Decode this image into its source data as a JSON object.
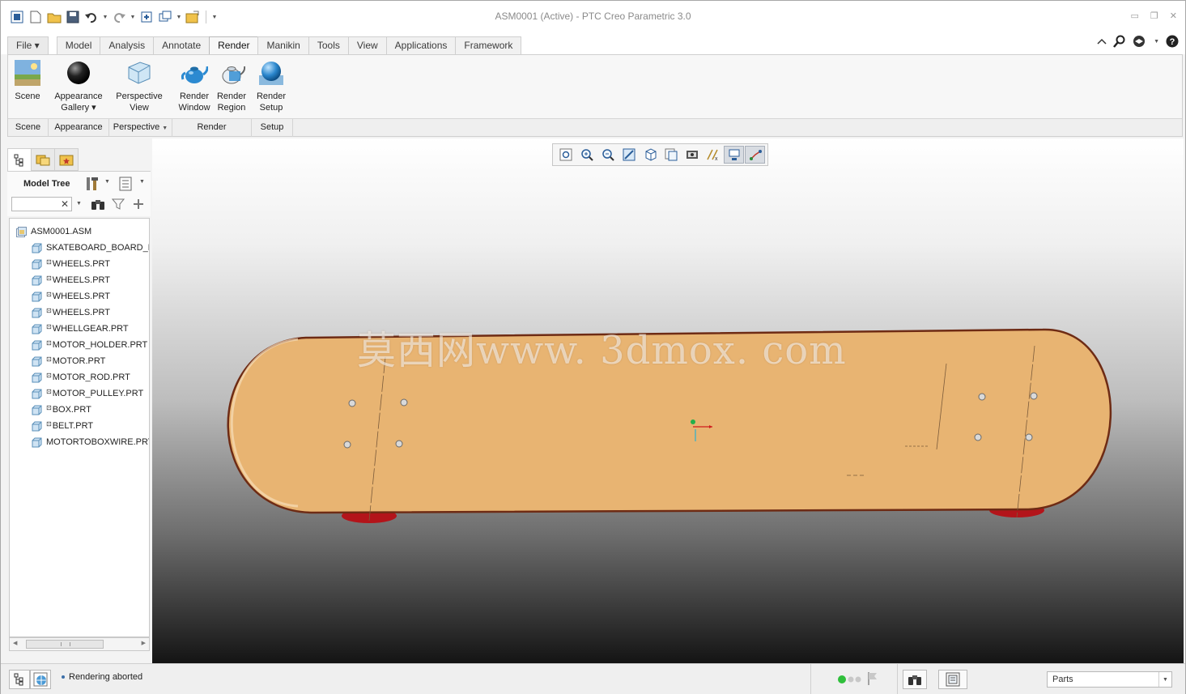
{
  "window": {
    "title": "ASM0001 (Active) - PTC Creo Parametric 3.0"
  },
  "tabs": [
    {
      "label": "File"
    },
    {
      "label": "Model"
    },
    {
      "label": "Analysis"
    },
    {
      "label": "Annotate"
    },
    {
      "label": "Render"
    },
    {
      "label": "Manikin"
    },
    {
      "label": "Tools"
    },
    {
      "label": "View"
    },
    {
      "label": "Applications"
    },
    {
      "label": "Framework"
    }
  ],
  "ribbon": {
    "buttons": {
      "scene": "Scene",
      "appearance_line1": "Appearance",
      "appearance_line2": "Gallery",
      "perspective_line1": "Perspective",
      "perspective_line2": "View",
      "render_window_line1": "Render",
      "render_window_line2": "Window",
      "render_region_line1": "Render",
      "render_region_line2": "Region",
      "render_setup_line1": "Render",
      "render_setup_line2": "Setup"
    },
    "groups": {
      "scene": "Scene",
      "appearance": "Appearance",
      "perspective": "Perspective",
      "render": "Render",
      "setup": "Setup"
    }
  },
  "model_tree": {
    "label": "Model Tree",
    "root": "ASM0001.ASM",
    "items": [
      {
        "name": "SKATEBOARD_BOARD_R",
        "mark": ""
      },
      {
        "name": "WHEELS.PRT",
        "mark": "⊡"
      },
      {
        "name": "WHEELS.PRT",
        "mark": "⊡"
      },
      {
        "name": "WHEELS.PRT",
        "mark": "⊡"
      },
      {
        "name": "WHEELS.PRT",
        "mark": "⊡"
      },
      {
        "name": "WHELLGEAR.PRT",
        "mark": "⊡"
      },
      {
        "name": "MOTOR_HOLDER.PRT",
        "mark": "⊡"
      },
      {
        "name": "MOTOR.PRT",
        "mark": "⊡"
      },
      {
        "name": "MOTOR_ROD.PRT",
        "mark": "⊡"
      },
      {
        "name": "MOTOR_PULLEY.PRT",
        "mark": "⊡"
      },
      {
        "name": "BOX.PRT",
        "mark": "⊡"
      },
      {
        "name": "BELT.PRT",
        "mark": "⊡"
      },
      {
        "name": "MOTORTOBOXWIRE.PRT",
        "mark": ""
      }
    ]
  },
  "viewport": {
    "watermark": "莫西网www. 3dmox. com"
  },
  "status": {
    "message": "Rendering aborted",
    "filter_value": "Parts"
  },
  "colors": {
    "board": "#e8b472",
    "board_edge": "#6e2b14",
    "wheels": "#b3141a"
  }
}
